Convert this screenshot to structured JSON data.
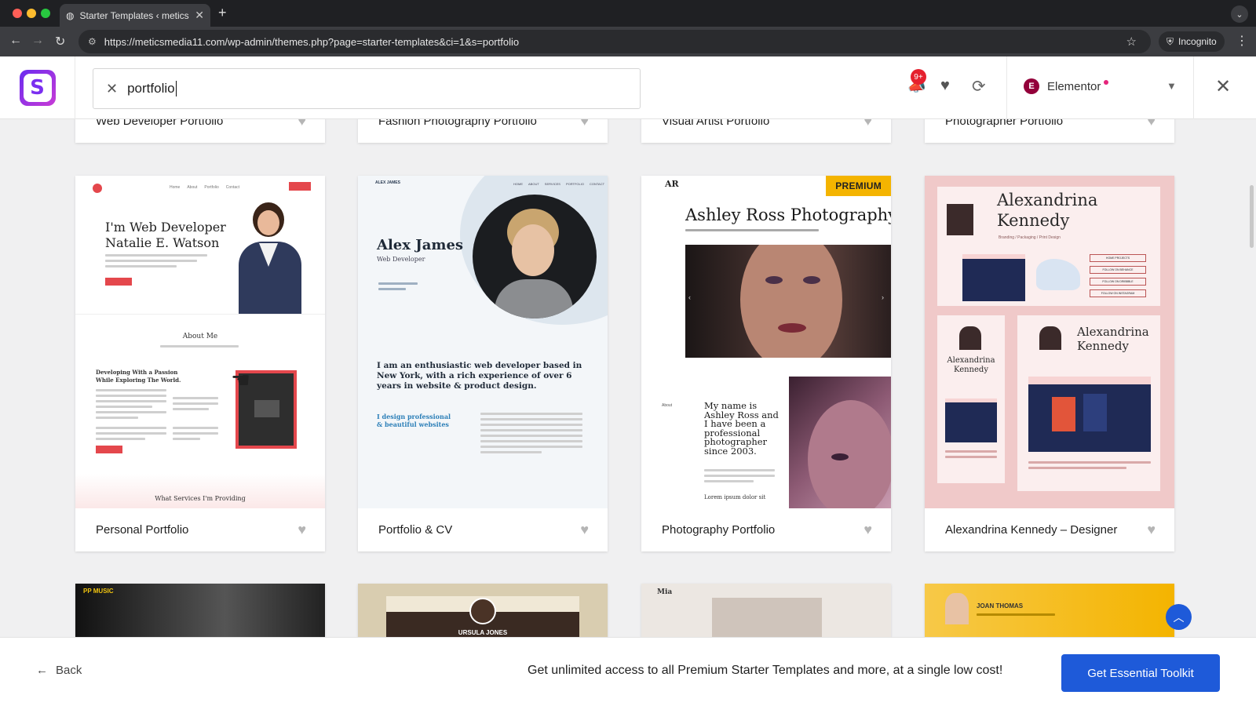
{
  "browser": {
    "tab_title": "Starter Templates ‹ meticsme",
    "url": "https://meticsmedia11.com/wp-admin/themes.php?page=starter-templates&ci=1&s=portfolio",
    "profile_label": "Incognito"
  },
  "header": {
    "search_value": "portfolio",
    "notification_count": "9+",
    "builder_name": "Elementor",
    "icons": [
      "megaphone-icon",
      "heart-icon",
      "sync-icon",
      "close-icon"
    ]
  },
  "top_row_cards": [
    {
      "title": "Web Developer Portfolio"
    },
    {
      "title": "Fashion Photography Portfolio"
    },
    {
      "title": "Visual Artist Portfolio"
    },
    {
      "title": "Photographer Portfolio"
    }
  ],
  "cards": [
    {
      "title": "Personal Portfolio",
      "preview": {
        "heading1": "I'm Web Developer",
        "heading2": "Natalie E. Watson",
        "about": "About Me",
        "passion1": "Developing With a Passion",
        "passion2": "While Exploring The World.",
        "services": "What Services I'm Providing",
        "nav": [
          "Home",
          "About",
          "Portfolio",
          "Contact"
        ]
      }
    },
    {
      "title": "Portfolio & CV",
      "preview": {
        "brand": "ALEX JAMES",
        "name": "Alex James",
        "role": "Web Developer",
        "bio": "I am an enthusiastic web developer based in New York, with a rich experience of over 6 years in website & product design.",
        "tagline": "I design professional & beautiful websites",
        "nav": [
          "HOME",
          "ABOUT",
          "SERVICES",
          "PORTFOLIO",
          "CONTACT"
        ]
      }
    },
    {
      "title": "Photography Portfolio",
      "premium_label": "PREMIUM",
      "preview": {
        "logo": "AR",
        "heading": "Ashley Ross Photography",
        "bio": "My name is Ashley Ross and I have been a professional photographer since 2003.",
        "about": "About",
        "lorem": "Lorem ipsum dolor sit"
      }
    },
    {
      "title": "Alexandrina Kennedy – Designer",
      "preview": {
        "name1": "Alexandrina",
        "name2": "Kennedy",
        "services": "Branding / Packaging / Print Design",
        "buttons": [
          "HOME PROJECTS",
          "FOLLOW ON BEHANCE",
          "FOLLOW ON DRIBBBLE",
          "FOLLOW ON INSTAGRAM"
        ]
      }
    }
  ],
  "bottom_row_cards": [
    {
      "preview_label": "PP MUSIC"
    },
    {
      "preview_label": "URSULA JONES"
    },
    {
      "preview_label": "Mia"
    },
    {
      "preview_label": "JOAN THOMAS"
    }
  ],
  "footer": {
    "back_label": "Back",
    "promo_text": "Get unlimited access to all Premium Starter Templates and more, at a single low cost!",
    "cta_label": "Get Essential Toolkit"
  },
  "colors": {
    "primary": "#1e5ad9",
    "premium": "#f4b400",
    "badge": "#e5202e",
    "elementor": "#93003a"
  }
}
